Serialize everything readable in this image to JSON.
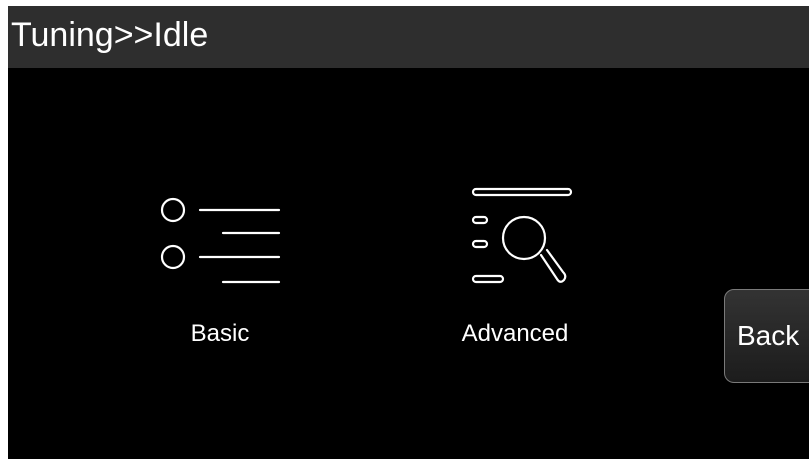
{
  "header": {
    "title": "Tuning>>Idle"
  },
  "menu": {
    "items": [
      {
        "label": "Basic",
        "icon": "list-radio-icon"
      },
      {
        "label": "Advanced",
        "icon": "search-list-icon"
      }
    ]
  },
  "controls": {
    "back_label": "Back"
  },
  "colors": {
    "background": "#000000",
    "header_bar": "#2e2e2e",
    "text": "#ffffff",
    "button_border": "#7a7a7a"
  }
}
